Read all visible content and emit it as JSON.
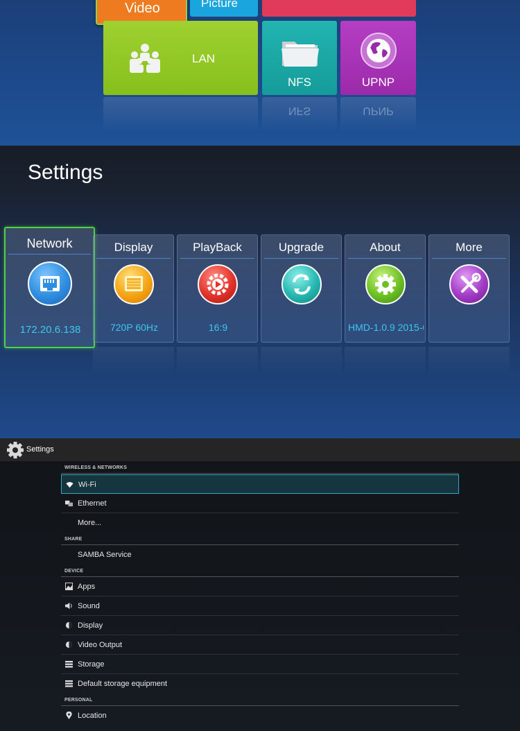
{
  "launcher": {
    "tiles": {
      "video": "Video",
      "picture": "Picture",
      "lan": "LAN",
      "nfs": "NFS",
      "upnp": "UPNP"
    },
    "reflections": {
      "nfs": "NFS",
      "upnp": "UPNP"
    },
    "colors": {
      "video": "#ee7b1f",
      "picture": "#1ba5df",
      "lan": "#9fd12f",
      "nfs": "#22b4b0",
      "upnp": "#b53ec3",
      "highlight": "#8fd14b"
    }
  },
  "settings_panel": {
    "title": "Settings",
    "cards": [
      {
        "title": "Network",
        "value": "172.20.6.138",
        "icon": "ethernet-icon",
        "color": "#2f8ee0"
      },
      {
        "title": "Display",
        "value": "720P 60Hz",
        "icon": "display-icon",
        "color": "#f5a414"
      },
      {
        "title": "PlayBack",
        "value": "16:9",
        "icon": "playback-icon",
        "color": "#e2332b"
      },
      {
        "title": "Upgrade",
        "value": "",
        "icon": "refresh-icon",
        "color": "#26b7b1"
      },
      {
        "title": "About",
        "value": "HMD-1.0.9 2015-0",
        "icon": "gear-icon",
        "color": "#6cc024"
      },
      {
        "title": "More",
        "value": "",
        "icon": "tools-icon",
        "color": "#a23bc6"
      }
    ],
    "selected_color": "#4fd24a",
    "value_color": "#3fc6ee"
  },
  "android_settings": {
    "action_bar_title": "Settings",
    "sections": {
      "wireless": "WIRELESS & NETWORKS",
      "share": "SHARE",
      "device": "DEVICE",
      "personal": "PERSONAL"
    },
    "items": {
      "wifi": "Wi-Fi",
      "ethernet": "Ethernet",
      "more": "More...",
      "samba": "SAMBA Service",
      "apps": "Apps",
      "sound": "Sound",
      "display": "Display",
      "video_output": "Video Output",
      "storage": "Storage",
      "default_storage": "Default storage equipment",
      "location": "Location"
    },
    "selected_color": "#3aa9c5"
  }
}
